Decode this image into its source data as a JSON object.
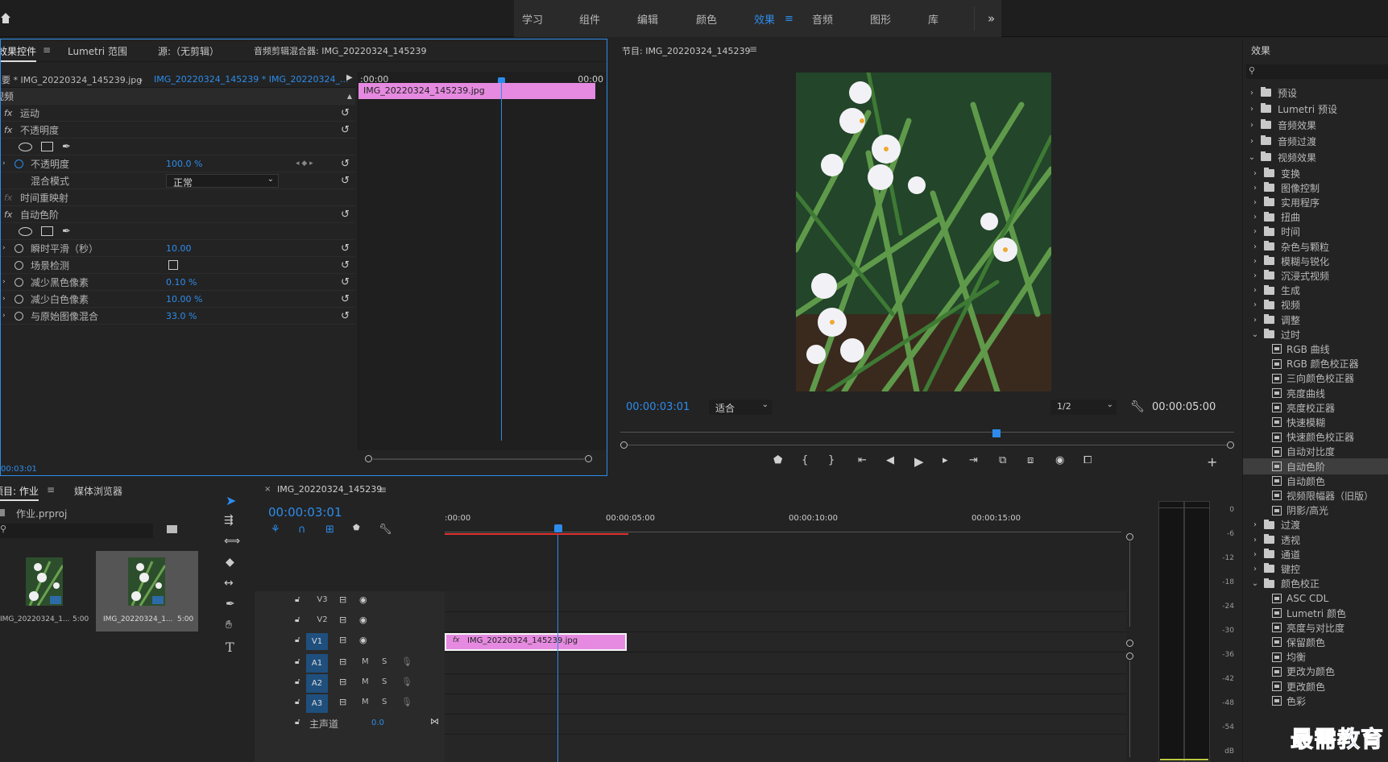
{
  "app": {
    "top_menu": [
      "学习",
      "组件",
      "编辑",
      "颜色",
      "效果",
      "音频",
      "图形",
      "库"
    ],
    "active_workspace": "效果",
    "more_glyph": "»"
  },
  "effect_controls": {
    "tabs": [
      "效果控件",
      "Lumetri 范围",
      "源:（无剪辑）",
      "音频剪辑混合器: IMG_20220324_145239"
    ],
    "tab_labels_display": [
      "效果控件",
      "Lumetri 范围",
      "源:（无剪辑）",
      "音频剪辑混合器: IMG_20220324_145239"
    ],
    "master_clip": "主要 * IMG_20220324_145239.jpg",
    "sequence_clip": "IMG_20220324_145239 * IMG_20220324_...",
    "section": "视频",
    "motion": "运动",
    "opacity": "不透明度",
    "opacity_prop": "不透明度",
    "opacity_value": "100.0 %",
    "blend_mode": "混合模式",
    "blend_value": "正常",
    "time_remap": "时间重映射",
    "auto_levels": "自动色阶",
    "temporal_smoothing": "瞬时平滑（秒）",
    "temporal_smoothing_value": "10.00",
    "scene_detect": "场景检测",
    "black_clip": "减少黑色像素",
    "black_clip_value": "0.10 %",
    "white_clip": "减少白色像素",
    "white_clip_value": "10.00 %",
    "blend_original": "与原始图像混合",
    "blend_original_value": "33.0 %",
    "timeline_start": ":00:00",
    "timeline_end": "00:00",
    "clip_name": "IMG_20220324_145239.jpg",
    "timecode": "00:03:01"
  },
  "program": {
    "title": "节目: IMG_20220324_145239",
    "timecode": "00:00:03:01",
    "fit": "适合",
    "resolution": "1/2",
    "duration": "00:00:05:00"
  },
  "effects_panel": {
    "title": "效果",
    "search_placeholder": "",
    "top_items": [
      "预设",
      "Lumetri 预设",
      "音频效果",
      "音频过渡",
      "视频效果"
    ],
    "video_effects_folders": [
      "变换",
      "图像控制",
      "实用程序",
      "扭曲",
      "时间",
      "杂色与颗粒",
      "模糊与锐化",
      "沉浸式视频",
      "生成",
      "视频",
      "调整",
      "过时"
    ],
    "obsolete_items": [
      "RGB 曲线",
      "RGB 颜色校正器",
      "三向颜色校正器",
      "亮度曲线",
      "亮度校正器",
      "快速模糊",
      "快速颜色校正器",
      "自动对比度",
      "自动色阶",
      "自动颜色",
      "视频限幅器（旧版）",
      "阴影/高光"
    ],
    "selected_item": "自动色阶",
    "more_folders": [
      "过渡",
      "透视",
      "通道",
      "键控",
      "颜色校正"
    ],
    "color_correction_items": [
      "ASC CDL",
      "Lumetri 颜色",
      "亮度与对比度",
      "保留颜色",
      "均衡",
      "更改为颜色",
      "更改颜色",
      "色彩"
    ]
  },
  "project": {
    "tabs": [
      "项目: 作业",
      "媒体浏览器"
    ],
    "file": "作业.prproj",
    "items": [
      {
        "name": "IMG_20220324_1...",
        "duration": "5:00"
      },
      {
        "name": "IMG_20220324_1...",
        "duration": "5:00"
      }
    ]
  },
  "timeline": {
    "title": "IMG_20220324_145239",
    "timecode": "00:00:03:01",
    "ruler": [
      ":00:00",
      "00:00:05:00",
      "00:00:10:00",
      "00:00:15:00"
    ],
    "video_tracks": [
      "V3",
      "V2",
      "V1"
    ],
    "audio_tracks": [
      "A1",
      "A2",
      "A3"
    ],
    "master": "主声道",
    "master_value": "0.0",
    "clip_name": "IMG_20220324_145239.jpg",
    "m_label": "M",
    "s_label": "S"
  },
  "audio_meter": {
    "ticks": [
      "0",
      "-6",
      "-12",
      "-18",
      "-24",
      "-30",
      "-36",
      "-42",
      "-48",
      "-54",
      "dB"
    ]
  },
  "watermark": "最需教育"
}
